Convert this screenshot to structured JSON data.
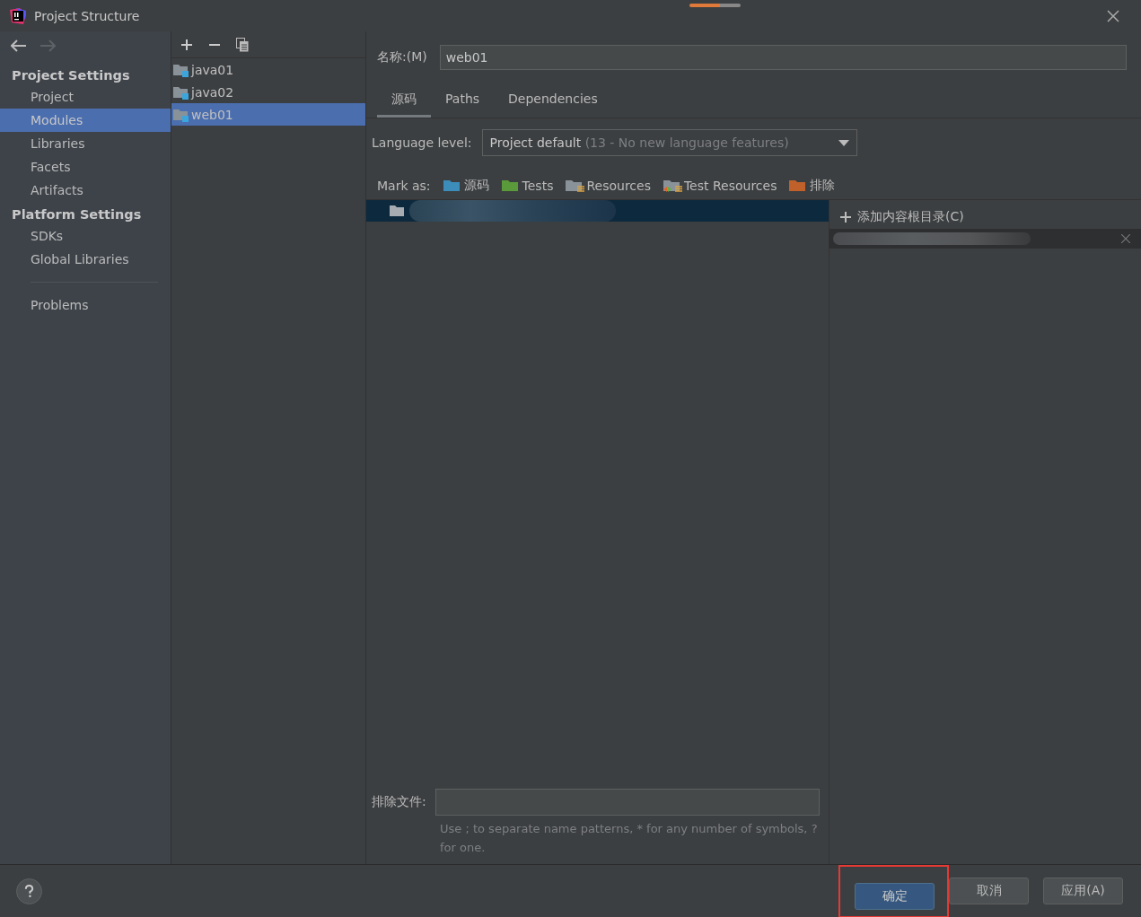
{
  "window": {
    "title": "Project Structure"
  },
  "sidebar": {
    "sections": [
      {
        "heading": "Project Settings",
        "items": [
          {
            "label": "Project",
            "selected": false
          },
          {
            "label": "Modules",
            "selected": true
          },
          {
            "label": "Libraries",
            "selected": false
          },
          {
            "label": "Facets",
            "selected": false
          },
          {
            "label": "Artifacts",
            "selected": false
          }
        ]
      },
      {
        "heading": "Platform Settings",
        "items": [
          {
            "label": "SDKs",
            "selected": false
          },
          {
            "label": "Global Libraries",
            "selected": false
          }
        ]
      },
      {
        "items": [
          {
            "label": "Problems",
            "selected": false
          }
        ]
      }
    ]
  },
  "modules": [
    {
      "name": "java01",
      "selected": false
    },
    {
      "name": "java02",
      "selected": false
    },
    {
      "name": "web01",
      "selected": true
    }
  ],
  "name_field": {
    "label": "名称:(M)",
    "value": "web01"
  },
  "tabs": [
    {
      "label": "源码",
      "selected": true
    },
    {
      "label": "Paths",
      "selected": false
    },
    {
      "label": "Dependencies",
      "selected": false
    }
  ],
  "language_level": {
    "label": "Language level:",
    "value": "Project default",
    "detail": "(13 - No new language features)"
  },
  "mark_as": {
    "label": "Mark as:",
    "items": [
      {
        "label": "源码",
        "kind": "source"
      },
      {
        "label": "Tests",
        "kind": "tests"
      },
      {
        "label": "Resources",
        "kind": "resources"
      },
      {
        "label": "Test Resources",
        "kind": "test-resources"
      },
      {
        "label": "排除",
        "kind": "excluded"
      }
    ]
  },
  "content_root": {
    "add_label": "添加内容根目录(C)"
  },
  "exclude_files": {
    "label": "排除文件:",
    "hint": "Use ; to separate name patterns, * for any number of symbols, ? for one."
  },
  "buttons": [
    {
      "label": "确定",
      "kind": "primary"
    },
    {
      "label": "取消",
      "kind": "default"
    },
    {
      "label": "应用(A)",
      "kind": "default"
    }
  ]
}
